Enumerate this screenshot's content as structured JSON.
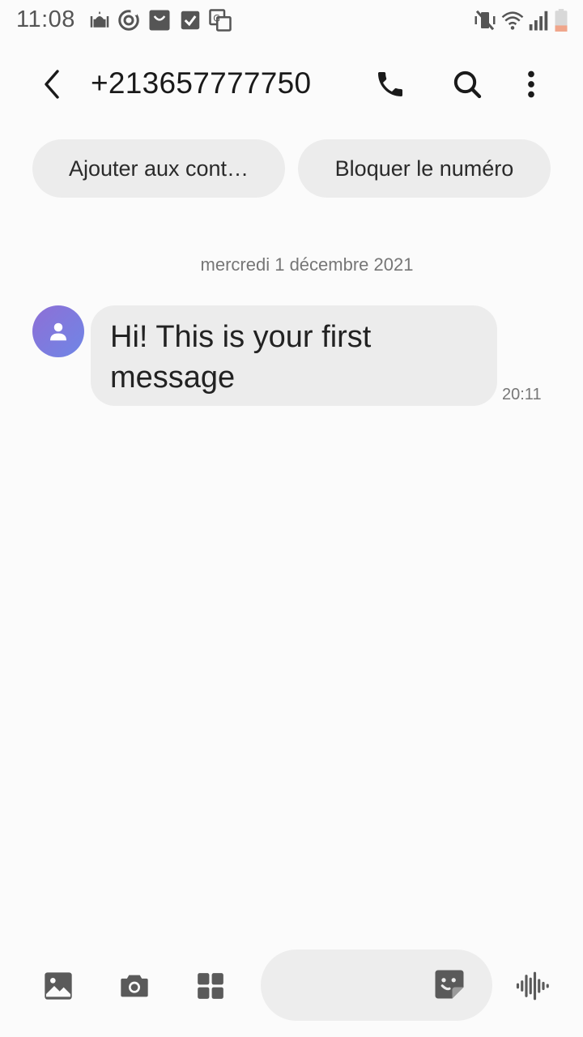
{
  "status_bar": {
    "time": "11:08",
    "left_icons": [
      "mosque-icon",
      "sync-icon",
      "shopping-bag-icon",
      "check-box-icon",
      "translate-icon"
    ],
    "right_icons": [
      "vibrate-mute-icon",
      "wifi-icon",
      "signal-icon",
      "battery-low-icon"
    ],
    "battery_color": "#f0a58a"
  },
  "header": {
    "title": "+213657777750",
    "back_icon": "back-arrow-icon",
    "actions": [
      "phone-icon",
      "search-icon",
      "more-vertical-icon"
    ]
  },
  "action_chips": [
    {
      "label": "Ajouter aux cont…"
    },
    {
      "label": "Bloquer le numéro"
    }
  ],
  "conversation": {
    "date_separator": "mercredi 1 décembre 2021",
    "messages": [
      {
        "text": "Hi! This is your first message",
        "time": "20:11",
        "direction": "incoming",
        "avatar_icon": "person-icon"
      }
    ]
  },
  "composer": {
    "value": "",
    "placeholder": "",
    "left_buttons": [
      "gallery-icon",
      "camera-icon",
      "apps-grid-icon"
    ],
    "inner_button": "sticker-icon",
    "right_button": "voice-wave-icon"
  },
  "colors": {
    "background": "#fbfbfb",
    "bubble": "#ececec",
    "chip": "#ececec",
    "avatar_gradient_start": "#8e6fd6",
    "avatar_gradient_end": "#6f86e6",
    "icon": "#1a1a1a",
    "muted_text": "#767676"
  }
}
